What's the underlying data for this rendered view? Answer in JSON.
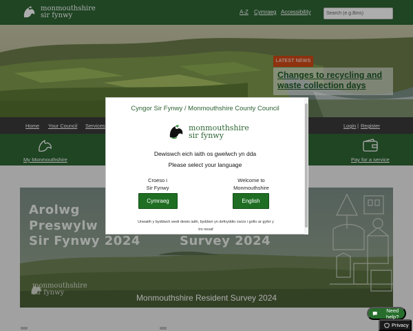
{
  "header": {
    "logo_line1": "monmouthshire",
    "logo_line2": "sir fynwy",
    "links": {
      "az": "A-Z",
      "cymraeg": "Cymraeg",
      "accessibility": "Accessibility"
    },
    "search_placeholder": "Search (e.g.Bins)"
  },
  "hero": {
    "badge": "LATEST NEWS",
    "headline": "Changes to recycling and waste collection days"
  },
  "subnav": {
    "items": [
      "Home",
      "Your Council",
      "Services"
    ],
    "login": "Login",
    "separator": "|",
    "register": "Register"
  },
  "quick_links": {
    "left": "My Monmouthshire",
    "right": "Pay for a service"
  },
  "banner": {
    "welsh_line1": "Arolwg",
    "welsh_line2": "Preswylw",
    "welsh_line3": "Sir Fynwy 2024",
    "english_line": "Survey 2024",
    "caption": "Monmouthshire Resident Survey 2024",
    "logo_line1": "monmouthshire",
    "logo_line2": "sir fynwy"
  },
  "modal": {
    "title": "Cyngor Sir Fynwy / Monmouthshire County Council",
    "logo_line1": "monmouthshire",
    "logo_line2": "sir fynwy",
    "prompt_welsh": "Dewiswch eich iaith os gwelwch yn dda",
    "prompt_english": "Please select your language",
    "welsh_label_1": "Croeso i",
    "welsh_label_2": "Sir Fynwy",
    "english_label_1": "Welcome to",
    "english_label_2": "Monmouthshire",
    "welsh_button": "Cymraeg",
    "english_button": "English",
    "note_1": "Unwaith y byddwch wedi dewis iaith, byddwn yn defnyddio cwcis i gofio ar gyfer y",
    "note_2": "tro nesaf"
  },
  "widgets": {
    "help": "Need help?",
    "privacy": "Privacy"
  },
  "colors": {
    "brand_green": "#2e6634",
    "button_green": "#1f6e23",
    "news_orange": "#d14a18",
    "dark_nav": "#3a3a3a"
  },
  "icons": [
    "dragon-logo-icon",
    "dragon-logo-icon",
    "wallet-icon",
    "chat-icon",
    "shield-icon"
  ]
}
